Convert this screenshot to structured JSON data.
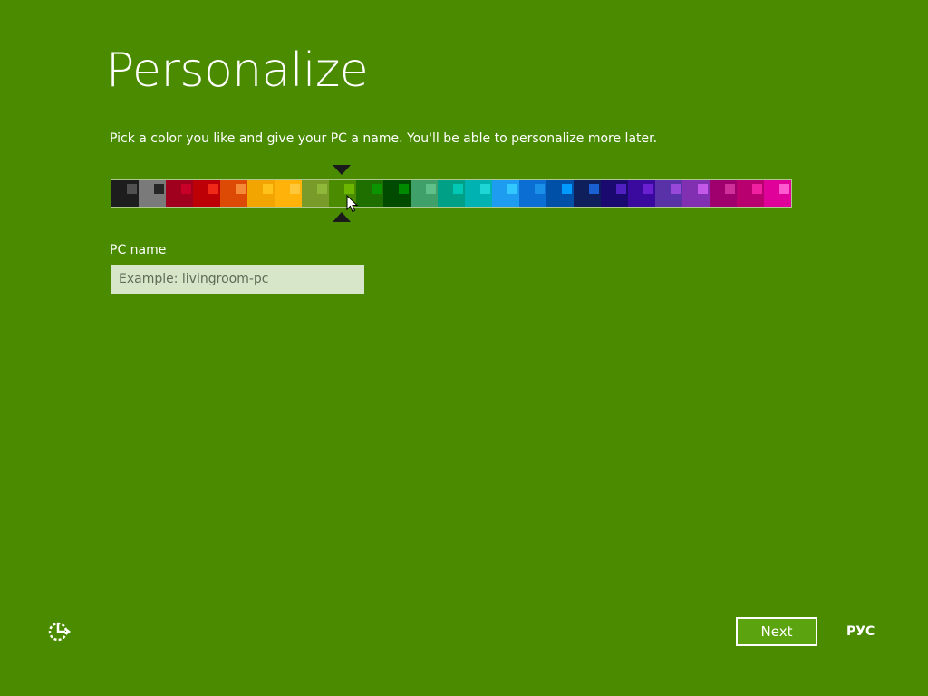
{
  "header": {
    "title": "Personalize",
    "subtitle": "Pick a color you like and give your PC a name. You'll be able to personalize more later."
  },
  "palette": {
    "selected_index": 8,
    "swatches": [
      {
        "bg": "#1d1d1d",
        "accent": "#505050"
      },
      {
        "bg": "#7a7a7a",
        "accent": "#262626"
      },
      {
        "bg": "#a0001e",
        "accent": "#c80028"
      },
      {
        "bg": "#bd0006",
        "accent": "#f02818"
      },
      {
        "bg": "#dc4a05",
        "accent": "#f58a38"
      },
      {
        "bg": "#f2a400",
        "accent": "#ffc21a"
      },
      {
        "bg": "#ffb20a",
        "accent": "#ffc83a"
      },
      {
        "bg": "#789b2a",
        "accent": "#8fb83a"
      },
      {
        "bg": "#4a8b00",
        "accent": "#6cb500"
      },
      {
        "bg": "#1e6e00",
        "accent": "#0c9400"
      },
      {
        "bg": "#004b00",
        "accent": "#008a00"
      },
      {
        "bg": "#40a06a",
        "accent": "#60c08a"
      },
      {
        "bg": "#00a087",
        "accent": "#00c8b4"
      },
      {
        "bg": "#00b2b2",
        "accent": "#1ed6d6"
      },
      {
        "bg": "#1e9cf0",
        "accent": "#32c8ff"
      },
      {
        "bg": "#0a6ed2",
        "accent": "#1a90e8"
      },
      {
        "bg": "#0050a8",
        "accent": "#009aff"
      },
      {
        "bg": "#0f1f5c",
        "accent": "#1a60d0"
      },
      {
        "bg": "#1a0a70",
        "accent": "#5020c0"
      },
      {
        "bg": "#3a0a9e",
        "accent": "#6a20d0"
      },
      {
        "bg": "#5a32a8",
        "accent": "#9848d8"
      },
      {
        "bg": "#8030b0",
        "accent": "#c458e8"
      },
      {
        "bg": "#a0006e",
        "accent": "#d0309a"
      },
      {
        "bg": "#b8006e",
        "accent": "#f020a0"
      },
      {
        "bg": "#e0009a",
        "accent": "#ff5ad0"
      }
    ]
  },
  "pc_name": {
    "label": "PC name",
    "placeholder": "Example: livingroom-pc",
    "value": ""
  },
  "footer": {
    "ease_icon": "ease-of-access-icon",
    "next_label": "Next",
    "language_label": "РУС"
  },
  "colors": {
    "background": "#4a8b00",
    "input_background": "#d7e6c9",
    "next_button_background": "#5ca40f"
  }
}
